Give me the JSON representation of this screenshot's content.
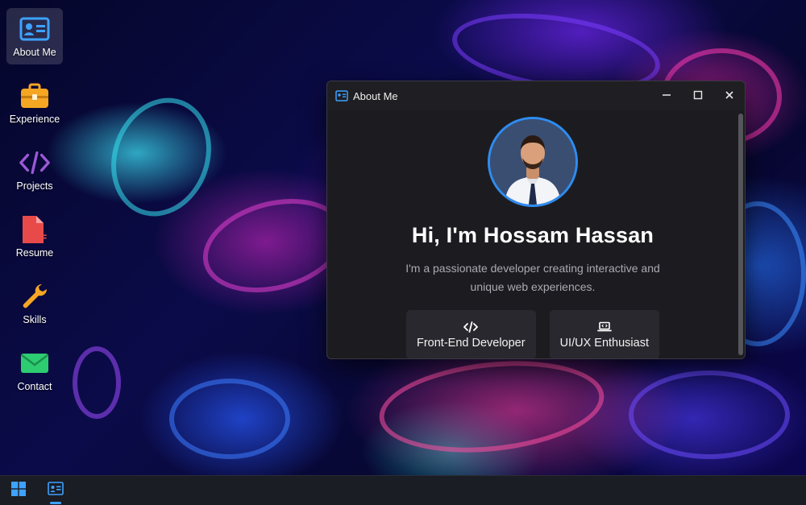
{
  "desktop": {
    "icons": [
      {
        "label": "About Me",
        "icon": "id-card-icon",
        "color": "#3ea2ff",
        "selected": true
      },
      {
        "label": "Experience",
        "icon": "briefcase-icon",
        "color": "#f5a623"
      },
      {
        "label": "Projects",
        "icon": "code-icon",
        "color": "#9b59d6"
      },
      {
        "label": "Resume",
        "icon": "pdf-file-icon",
        "color": "#e84a4a"
      },
      {
        "label": "Skills",
        "icon": "wrench-icon",
        "color": "#f5a623"
      },
      {
        "label": "Contact",
        "icon": "envelope-icon",
        "color": "#2ecc71"
      }
    ]
  },
  "window": {
    "title": "About Me",
    "icon": "id-card-icon",
    "controls": {
      "minimize": "minimize-icon",
      "maximize": "maximize-icon",
      "close": "close-icon"
    },
    "content": {
      "heading": "Hi, I'm Hossam Hassan",
      "bio": "I'm a passionate developer creating interactive and unique web experiences.",
      "roles": [
        {
          "label": "Front-End Developer",
          "icon": "code-icon"
        },
        {
          "label": "UI/UX Enthusiast",
          "icon": "laptop-code-icon"
        }
      ]
    }
  },
  "taskbar": {
    "start_icon": "windows-logo-icon",
    "open_apps": [
      {
        "icon": "id-card-icon",
        "active": true
      }
    ]
  },
  "colors": {
    "accent": "#3ea2ff",
    "avatar_ring": "#2f8cf0",
    "window_bg": "#1c1c20",
    "taskbar_bg": "#1b1d24"
  }
}
